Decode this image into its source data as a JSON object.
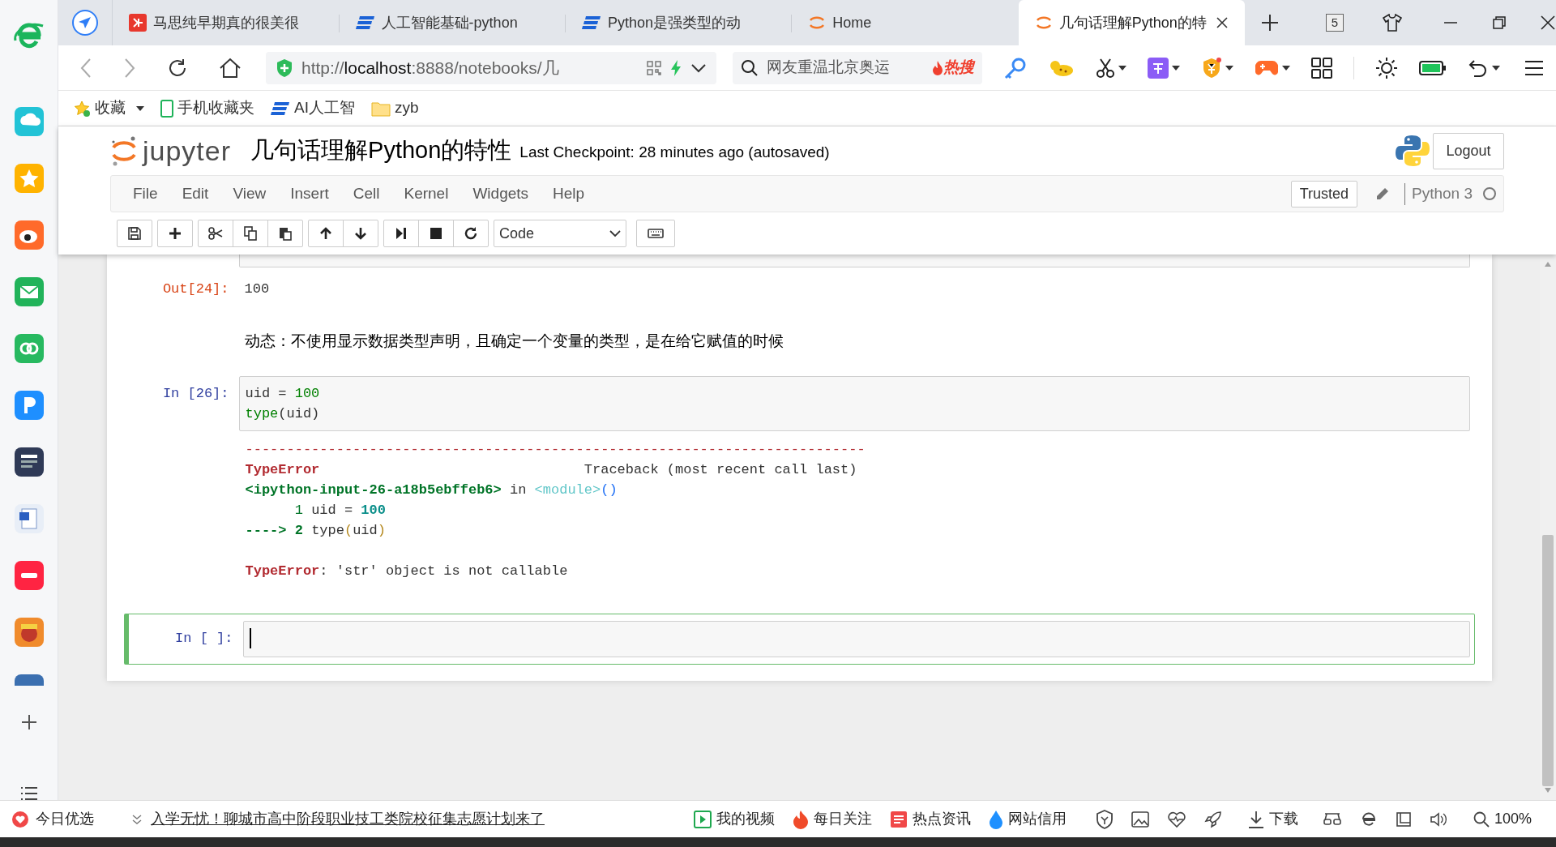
{
  "browser": {
    "tabs": [
      {
        "title": "马思纯早期真的很美很",
        "selected": false
      },
      {
        "title": "人工智能基础-python",
        "selected": false
      },
      {
        "title": "Python是强类型的动",
        "selected": false
      },
      {
        "title": "Home",
        "selected": false
      },
      {
        "title": "几句话理解Python的特",
        "selected": true
      }
    ],
    "tab_count": "5",
    "address": {
      "scheme": "http://",
      "host": "localhost",
      "rest": ":8888/notebooks/几"
    },
    "search": {
      "placeholder": "网友重温北京奥运",
      "hot": "热搜"
    },
    "bookmarks": [
      "收藏",
      "手机收藏夹",
      "AI人工智",
      "zyb"
    ]
  },
  "jupyter": {
    "logo": "jupyter",
    "title": "几句话理解Python的特性",
    "checkpoint": "Last Checkpoint: 28 minutes ago (autosaved)",
    "logout": "Logout",
    "menu": [
      "File",
      "Edit",
      "View",
      "Insert",
      "Cell",
      "Kernel",
      "Widgets",
      "Help"
    ],
    "trusted": "Trusted",
    "kernel": "Python 3",
    "kernel_busy": false,
    "cell_type": "Code"
  },
  "cells": [
    {
      "kind": "clipped_cell"
    },
    {
      "kind": "output",
      "prompt": "Out[24]:",
      "text": "100"
    },
    {
      "kind": "markdown",
      "text": "动态：不使用显示数据类型声明，且确定一个变量的类型，是在给它赋值的时候"
    },
    {
      "kind": "code",
      "prompt": "In [26]:",
      "selected": false,
      "lines": [
        [
          {
            "text": "uid = ",
            "kind": "plain"
          },
          {
            "text": "100",
            "kind": "number"
          }
        ],
        [
          {
            "text": "type",
            "kind": "builtin"
          },
          {
            "text": "(uid)",
            "kind": "plain"
          }
        ]
      ],
      "traceback": [
        [
          {
            "text": "---------------------------------------------------------------------------",
            "kind": "rule"
          }
        ],
        [
          {
            "text": "TypeError",
            "kind": "error_name"
          },
          {
            "text": "                                Traceback (most recent call last)",
            "kind": "plain"
          }
        ],
        [
          {
            "text": "<ipython-input-26-a18b5ebffeb6>",
            "kind": "file"
          },
          {
            "text": " in ",
            "kind": "plain"
          },
          {
            "text": "<module>",
            "kind": "module"
          },
          {
            "text": "()",
            "kind": "paren"
          }
        ],
        [
          {
            "text": "      1 ",
            "kind": "lineno"
          },
          {
            "text": "uid = ",
            "kind": "plain"
          },
          {
            "text": "100",
            "kind": "literal"
          }
        ],
        [
          {
            "text": "----> 2 ",
            "kind": "arrow"
          },
          {
            "text": "type",
            "kind": "plain"
          },
          {
            "text": "(",
            "kind": "bracket"
          },
          {
            "text": "uid",
            "kind": "plain"
          },
          {
            "text": ")",
            "kind": "bracket"
          }
        ]
      ],
      "message": [
        {
          "text": "TypeError",
          "kind": "error_name"
        },
        {
          "text": ": 'str' object is not callable",
          "kind": "plain"
        }
      ]
    },
    {
      "kind": "code",
      "prompt": "In [ ]:",
      "selected": true
    }
  ],
  "status_bar": {
    "left": "今日优选",
    "news": "入学无忧！聊城市高中阶段职业技工类院校征集志愿计划来了",
    "items": [
      "我的视频",
      "每日关注",
      "热点资讯",
      "网站信用"
    ],
    "download": "下载",
    "zoom": "100%"
  }
}
